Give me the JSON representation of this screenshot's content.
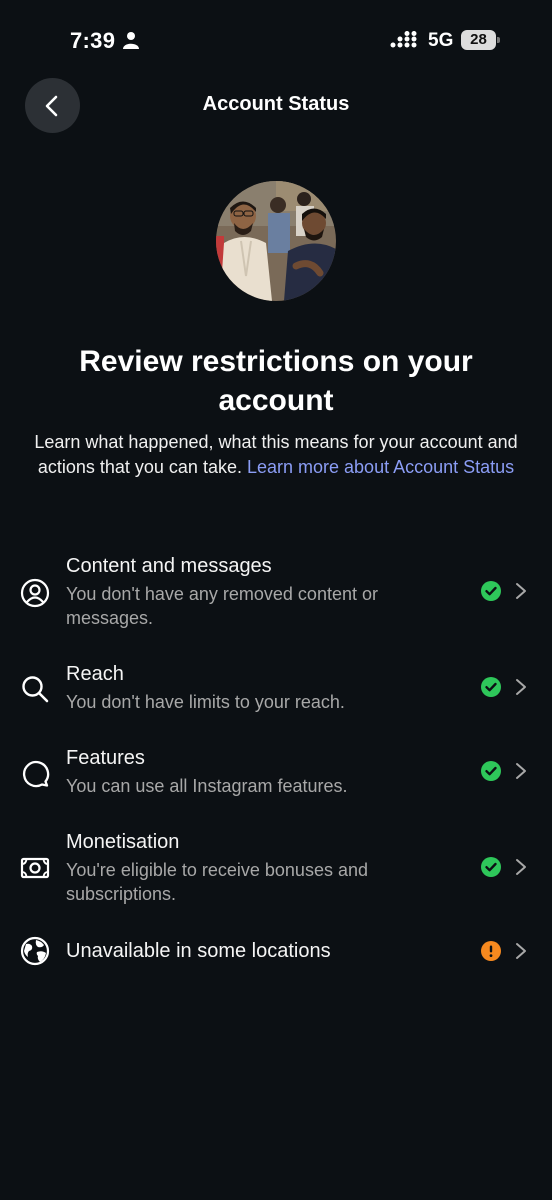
{
  "status_bar": {
    "time": "7:39",
    "network": "5G",
    "battery": "28"
  },
  "header": {
    "title": "Account Status"
  },
  "main": {
    "heading": "Review restrictions on your account",
    "intro_text": "Learn what happened, what this means for your account and actions that you can take. ",
    "learn_more_link": "Learn more about Account Status"
  },
  "items": [
    {
      "title": "Content and messages",
      "subtitle": "You don't have any removed content or messages.",
      "icon": "person-circle-icon",
      "status": "ok"
    },
    {
      "title": "Reach",
      "subtitle": "You don't have limits to your reach.",
      "icon": "search-icon",
      "status": "ok"
    },
    {
      "title": "Features",
      "subtitle": "You can use all Instagram features.",
      "icon": "chat-bubble-icon",
      "status": "ok"
    },
    {
      "title": "Monetisation",
      "subtitle": "You're eligible to receive bonuses and subscriptions.",
      "icon": "banknote-icon",
      "status": "ok"
    },
    {
      "title": "Unavailable in some locations",
      "subtitle": "",
      "icon": "globe-icon",
      "status": "warning"
    }
  ],
  "colors": {
    "background": "#0c1014",
    "ok": "#2ec75a",
    "warning": "#f6891f",
    "link": "#8b9df5"
  }
}
